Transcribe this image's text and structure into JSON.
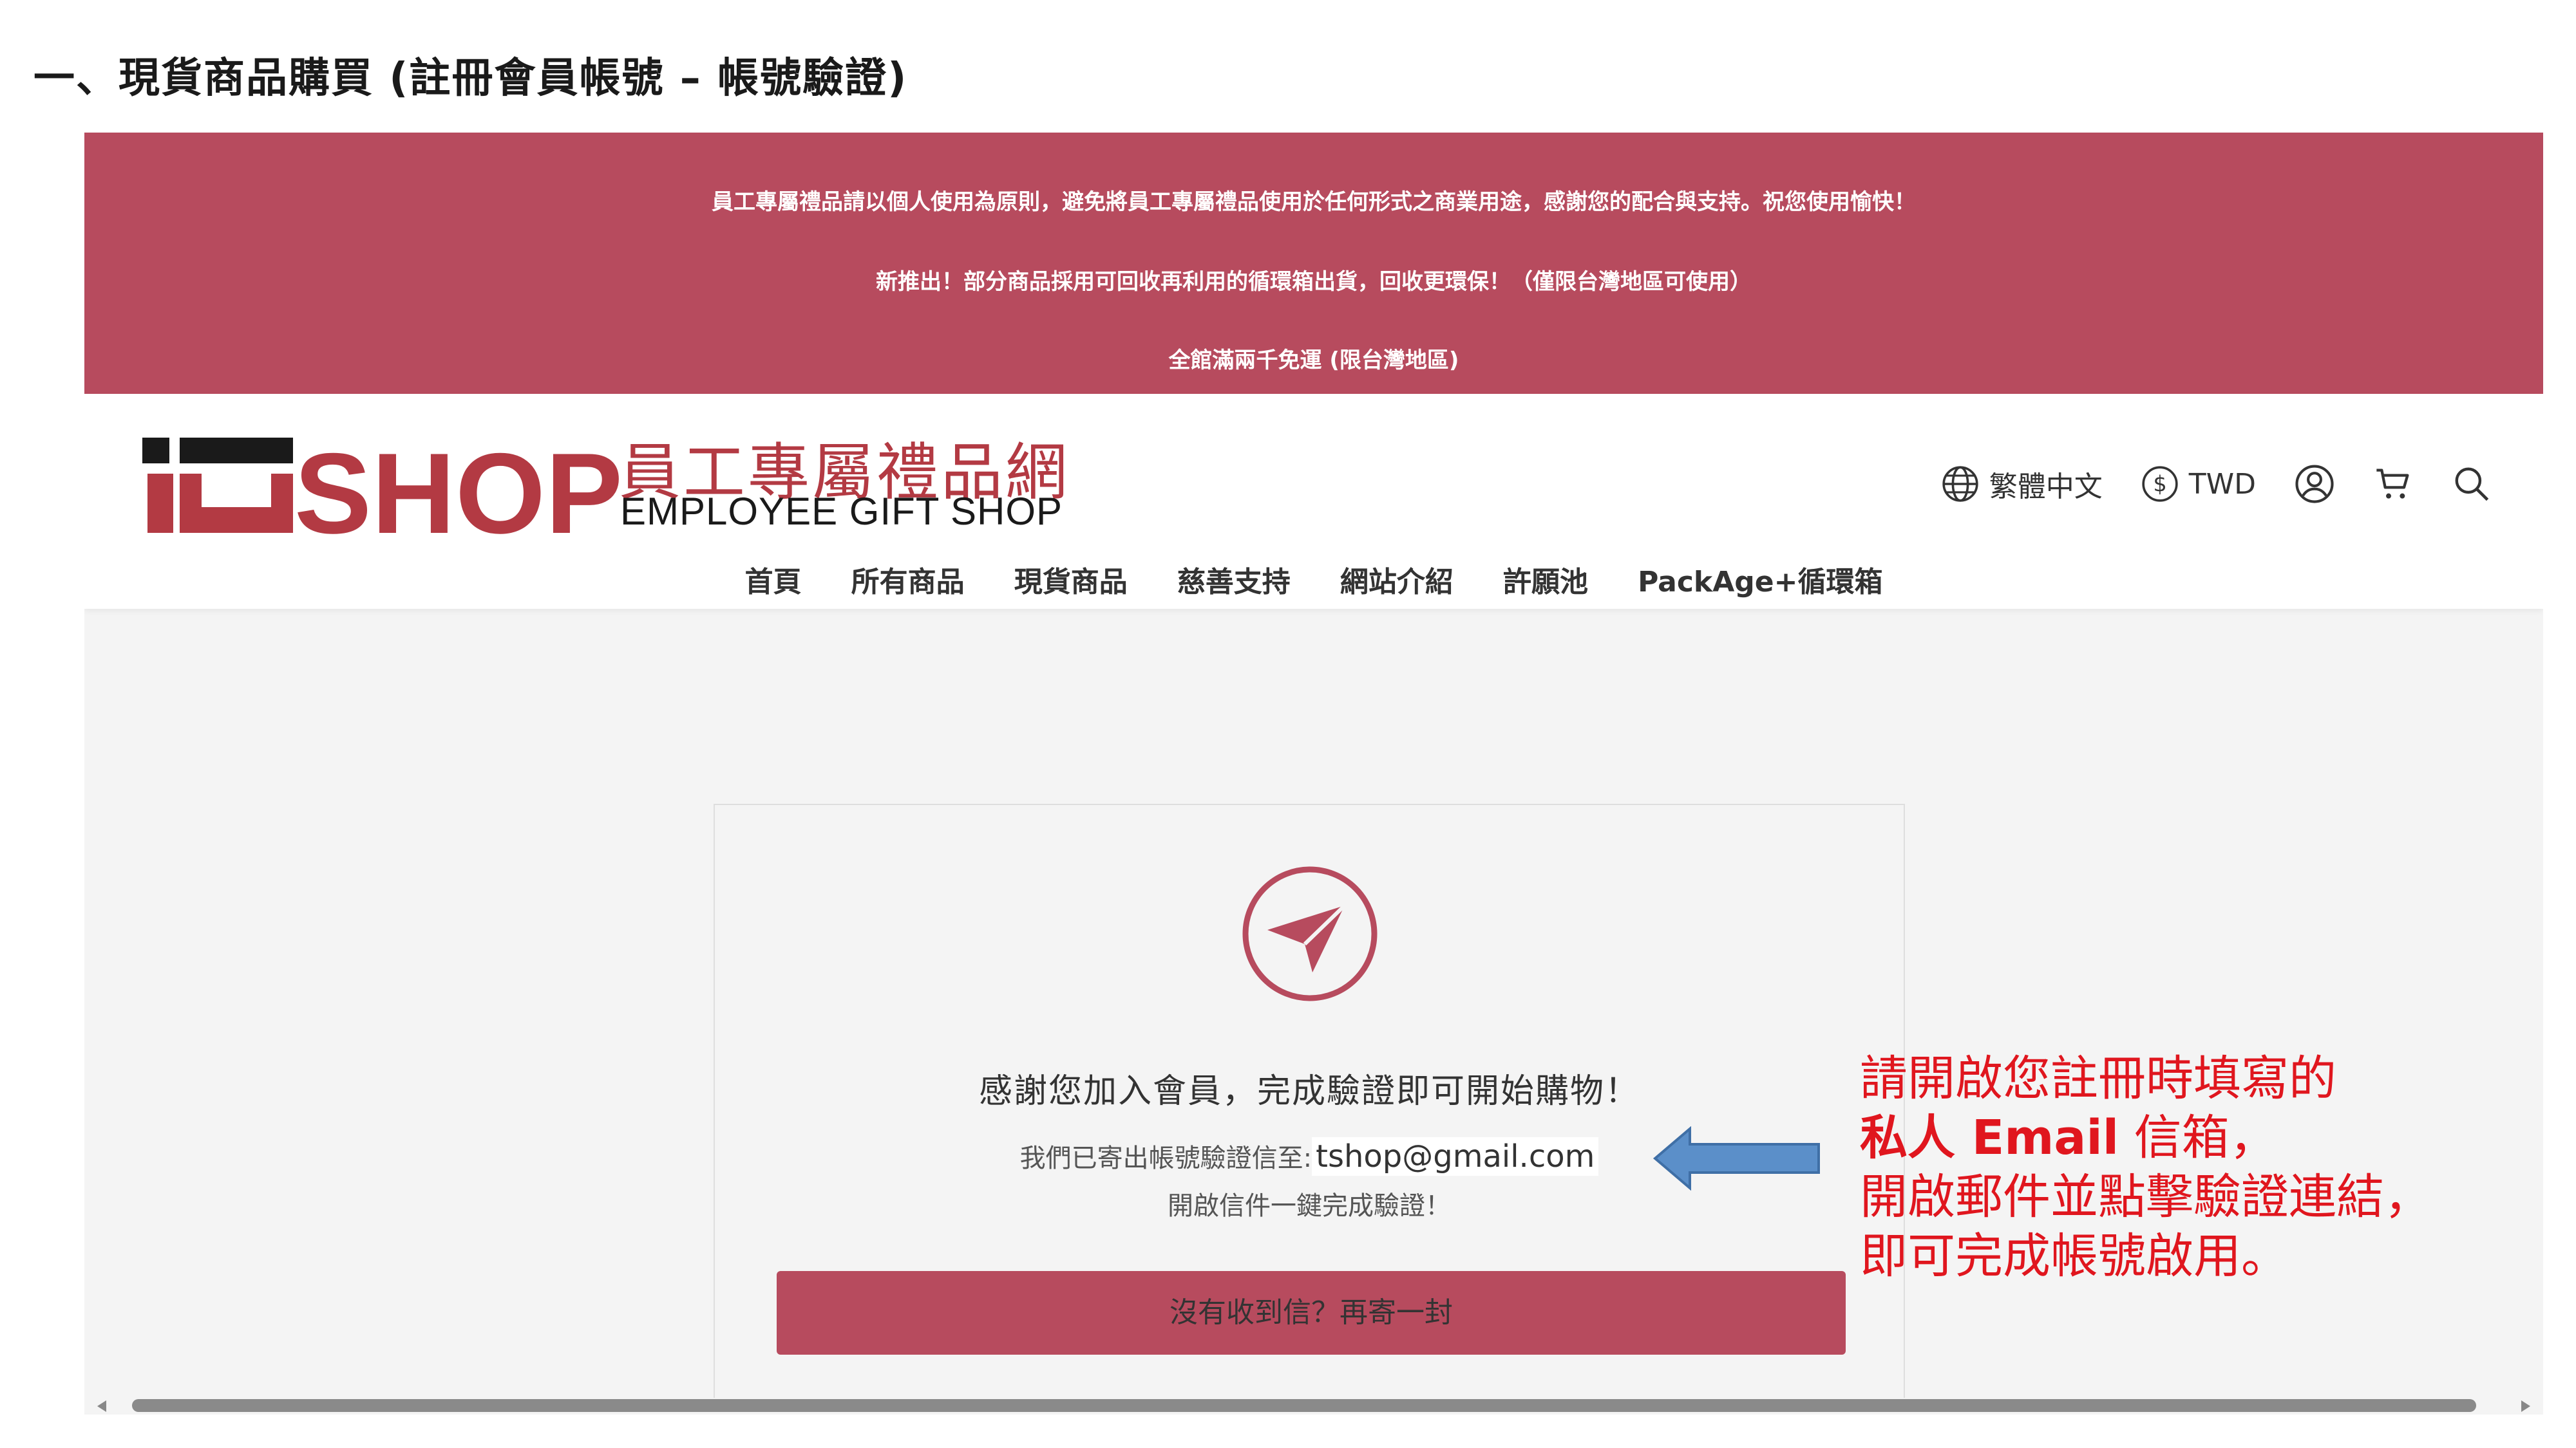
{
  "doc_heading": "一、現貨商品購買 (註冊會員帳號 – 帳號驗證)",
  "announcements": [
    "員工專屬禮品請以個人使用為原則，避免將員工專屬禮品使用於任何形式之商業用途，感謝您的配合與支持。祝您使用愉快！",
    "新推出！部分商品採用可回收再利用的循環箱出貨，回收更環保！（僅限台灣地區可使用）",
    "全館滿兩千免運 (限台灣地區)"
  ],
  "logo": {
    "mark_text": "SHOP",
    "cn": "員工專屬禮品網",
    "en": "EMPLOYEE GIFT SHOP"
  },
  "header_tools": {
    "language": "繁體中文",
    "currency": "TWD",
    "icons": [
      "globe-icon",
      "dollar-circle-icon",
      "user-icon",
      "cart-icon",
      "search-icon"
    ]
  },
  "nav": [
    "首頁",
    "所有商品",
    "現貨商品",
    "慈善支持",
    "網站介紹",
    "許願池",
    "PackAge+循環箱"
  ],
  "verify": {
    "icon": "paper-plane-icon",
    "title": "感謝您加入會員，完成驗證即可開始購物！",
    "sent_prefix": "我們已寄出帳號驗證信至:",
    "email": "tshop@gmail.com",
    "open_hint": "開啟信件一鍵完成驗證！",
    "resend_label": "沒有收到信？再寄一封"
  },
  "annotation": {
    "line1": "請開啟您註冊時填寫的",
    "line2_bold": "私人 Email",
    "line2_rest": " 信箱，",
    "line3": "開啟郵件並點擊驗證連結，",
    "line4": "即可完成帳號啟用。"
  },
  "colors": {
    "brand": "#b74b5e",
    "annotation": "#e0161e",
    "arrow_fill": "#5b8fc9",
    "logo_red": "#b33a43"
  }
}
